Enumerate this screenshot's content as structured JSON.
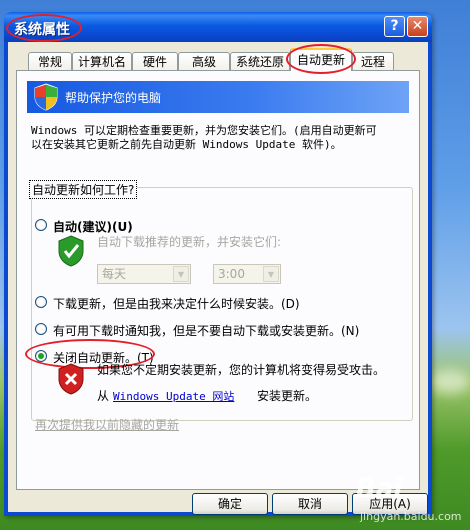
{
  "dialog": {
    "title": "系统属性",
    "help_label": "?",
    "close_label": "✕"
  },
  "tabs": [
    {
      "label": "常规"
    },
    {
      "label": "计算机名"
    },
    {
      "label": "硬件"
    },
    {
      "label": "高级"
    },
    {
      "label": "系统还原"
    },
    {
      "label": "自动更新",
      "active": true
    },
    {
      "label": "远程"
    }
  ],
  "banner": {
    "text": "帮助保护您的电脑",
    "icon": "shield-icon"
  },
  "description": {
    "line1": "Windows 可以定期检查重要更新，并为您安装它们。(启用自动更新可",
    "line2": "以在安装其它更新之前先自动更新 Windows Update 软件)。"
  },
  "group": {
    "legend": "自动更新如何工作?"
  },
  "options": {
    "auto": {
      "label": "自动(建议)(U)",
      "desc": "自动下载推荐的更新，并安装它们:",
      "day_value": "每天",
      "time_value": "3:00",
      "checked": false
    },
    "download": {
      "label": "下载更新，但是由我来决定什么时候安装。(D)",
      "checked": false
    },
    "notify": {
      "label": "有可用下载时通知我，但是不要自动下载或安装更新。(N)",
      "checked": false
    },
    "off": {
      "label": "关闭自动更新。(T)",
      "checked": true,
      "warning": "如果您不定期安装更新，您的计算机将变得易受攻击。",
      "from_text": "从",
      "link_text": "Windows Update 网站",
      "suffix": "安装更新。"
    }
  },
  "hidden_updates_link": "再次提供我以前隐藏的更新",
  "buttons": {
    "ok": "确定",
    "cancel": "取消",
    "apply": "应用(A)"
  },
  "watermark": {
    "brand": "Bai",
    "sub": "jingyan.baidu.com"
  },
  "colors": {
    "accent_red": "#e2202a",
    "titlebar_blue": "#0a49d0",
    "link_blue": "#0000c8"
  }
}
